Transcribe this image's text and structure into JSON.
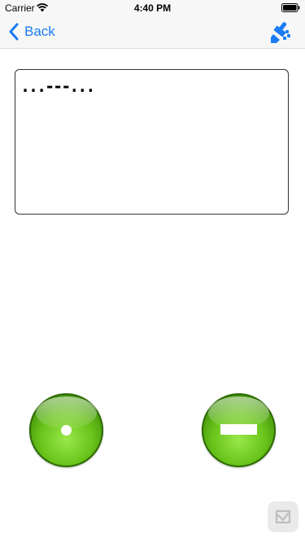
{
  "status_bar": {
    "carrier": "Carrier",
    "time": "4:40 PM"
  },
  "nav": {
    "back_label": "Back",
    "back_icon": "chevron-left-icon",
    "action_icon": "paintbrush-icon",
    "tint_color": "#1b7cf4"
  },
  "text_panel": {
    "value": "...---..."
  },
  "keys": {
    "dot_icon": "dot",
    "dash_icon": "dash",
    "button_color": "#5fb716"
  },
  "corner_badge": {
    "icon": "app-badge-icon"
  }
}
